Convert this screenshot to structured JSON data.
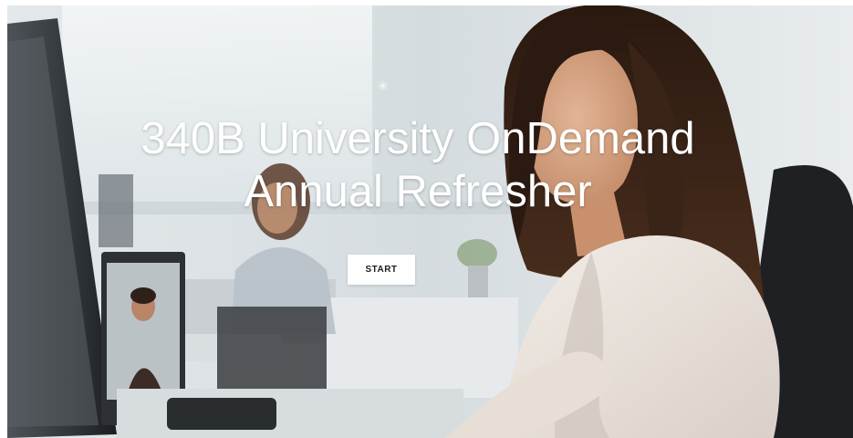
{
  "hero": {
    "title_line1": "340B University OnDemand",
    "title_line2": "Annual Refresher",
    "start_label": "START",
    "sparkle_glyph": "✳"
  },
  "colors": {
    "background": "#dfe4e7",
    "title": "#ffffff",
    "button_bg": "#ffffff",
    "button_text": "#1d1d1d",
    "hair": "#3a2418",
    "blouse": "#ece4dc",
    "monitor": "#2b2f33",
    "chair": "#1e1f22"
  },
  "icons": {
    "sparkle": "sparkle-icon"
  }
}
